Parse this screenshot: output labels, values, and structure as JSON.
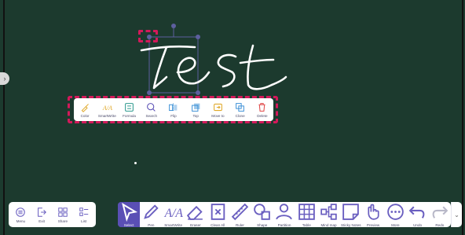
{
  "board": {
    "background": "#1c3a2e",
    "side_handle_icon": "chevron-right-icon",
    "side_handle_glyph": "›"
  },
  "selection": {
    "handle_color": "#5d5f9e",
    "highlight_color": "#d3195a"
  },
  "context_toolbar": {
    "items": [
      {
        "label": "Color",
        "icon": "color-brush-icon",
        "color": "#e0a92b"
      },
      {
        "label": "SmartWrite",
        "icon": "smartwrite-icon",
        "color": "#e0a92b"
      },
      {
        "label": "Formula",
        "icon": "formula-icon",
        "color": "#2f9a8f"
      },
      {
        "label": "Search",
        "icon": "search-icon",
        "color": "#5a4fb5"
      },
      {
        "label": "Flip",
        "icon": "flip-icon",
        "color": "#3a8fd6"
      },
      {
        "label": "Top",
        "icon": "bring-to-top-icon",
        "color": "#3a8fd6"
      },
      {
        "label": "Move to",
        "icon": "move-to-icon",
        "color": "#e0a92b"
      },
      {
        "label": "Clone",
        "icon": "clone-icon",
        "color": "#3a8fd6"
      },
      {
        "label": "Delete",
        "icon": "trash-icon",
        "color": "#e04848"
      }
    ]
  },
  "left_toolbar": {
    "items": [
      {
        "label": "Menu",
        "icon": "menu-icon"
      },
      {
        "label": "Exit",
        "icon": "exit-icon"
      },
      {
        "label": "Share",
        "icon": "share-icon"
      },
      {
        "label": "List",
        "icon": "list-icon"
      }
    ]
  },
  "main_toolbar": {
    "items": [
      {
        "label": "Select",
        "icon": "cursor-icon"
      },
      {
        "label": "Pen",
        "icon": "pen-icon"
      },
      {
        "label": "SmartWrite",
        "icon": "smartwrite-icon"
      },
      {
        "label": "Eraser",
        "icon": "eraser-icon"
      },
      {
        "label": "Clean All",
        "icon": "clean-all-icon"
      },
      {
        "label": "Ruler",
        "icon": "ruler-icon"
      },
      {
        "label": "Shape",
        "icon": "shape-icon"
      },
      {
        "label": "Partition",
        "icon": "partition-icon"
      },
      {
        "label": "Table",
        "icon": "table-icon"
      },
      {
        "label": "Mind map",
        "icon": "mind-map-icon"
      },
      {
        "label": "Sticky Notes",
        "icon": "sticky-notes-icon"
      },
      {
        "label": "Preview",
        "icon": "preview-icon"
      },
      {
        "label": "More",
        "icon": "more-icon"
      },
      {
        "label": "Undo",
        "icon": "undo-icon"
      },
      {
        "label": "Redo",
        "icon": "redo-icon"
      }
    ],
    "active": "Select",
    "collapse_icon": "chevron-down-icon",
    "collapse_glyph": "⌄"
  }
}
